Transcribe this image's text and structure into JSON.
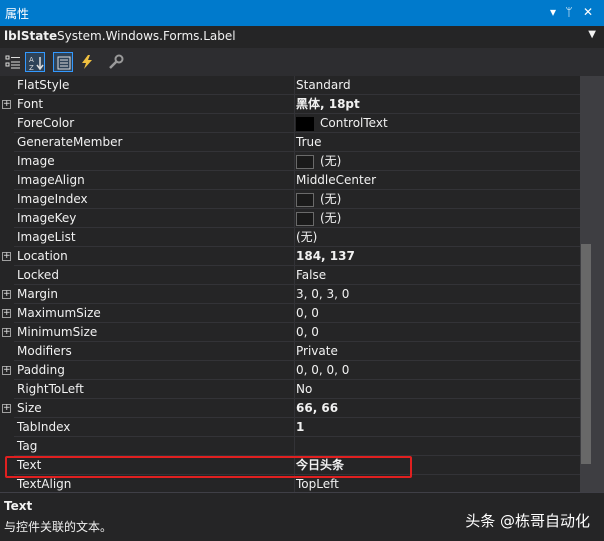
{
  "window": {
    "title": "属性"
  },
  "title_buttons": {
    "dropdown": "▾",
    "pin": "ᛘ",
    "close": "✕"
  },
  "object_selector": {
    "name": "lblState",
    "type": "System.Windows.Forms.Label"
  },
  "toolbar": {
    "buttons": [
      {
        "name": "categorized-icon",
        "active": false
      },
      {
        "name": "alphabetical-sort-icon",
        "active": true
      },
      {
        "name": "properties-icon",
        "active": true
      },
      {
        "name": "events-lightning-icon",
        "active": false
      },
      {
        "name": "property-pages-wrench-icon",
        "active": false
      }
    ]
  },
  "properties": [
    {
      "name": "FlatStyle",
      "value": "Standard",
      "expandable": false,
      "bold": false,
      "swatch": "none"
    },
    {
      "name": "Font",
      "value": "黑体, 18pt",
      "expandable": true,
      "bold": true,
      "swatch": "none"
    },
    {
      "name": "ForeColor",
      "value": "ControlText",
      "expandable": false,
      "bold": false,
      "swatch": "black"
    },
    {
      "name": "GenerateMember",
      "value": "True",
      "expandable": false,
      "bold": false,
      "swatch": "none"
    },
    {
      "name": "Image",
      "value": "(无)",
      "expandable": false,
      "bold": false,
      "swatch": "empty"
    },
    {
      "name": "ImageAlign",
      "value": "MiddleCenter",
      "expandable": false,
      "bold": false,
      "swatch": "none"
    },
    {
      "name": "ImageIndex",
      "value": "(无)",
      "expandable": false,
      "bold": false,
      "swatch": "empty"
    },
    {
      "name": "ImageKey",
      "value": "(无)",
      "expandable": false,
      "bold": false,
      "swatch": "empty"
    },
    {
      "name": "ImageList",
      "value": "(无)",
      "expandable": false,
      "bold": false,
      "swatch": "none"
    },
    {
      "name": "Location",
      "value": "184, 137",
      "expandable": true,
      "bold": true,
      "swatch": "none"
    },
    {
      "name": "Locked",
      "value": "False",
      "expandable": false,
      "bold": false,
      "swatch": "none"
    },
    {
      "name": "Margin",
      "value": "3, 0, 3, 0",
      "expandable": true,
      "bold": false,
      "swatch": "none"
    },
    {
      "name": "MaximumSize",
      "value": "0, 0",
      "expandable": true,
      "bold": false,
      "swatch": "none"
    },
    {
      "name": "MinimumSize",
      "value": "0, 0",
      "expandable": true,
      "bold": false,
      "swatch": "none"
    },
    {
      "name": "Modifiers",
      "value": "Private",
      "expandable": false,
      "bold": false,
      "swatch": "none"
    },
    {
      "name": "Padding",
      "value": "0, 0, 0, 0",
      "expandable": true,
      "bold": false,
      "swatch": "none"
    },
    {
      "name": "RightToLeft",
      "value": "No",
      "expandable": false,
      "bold": false,
      "swatch": "none"
    },
    {
      "name": "Size",
      "value": "66, 66",
      "expandable": true,
      "bold": true,
      "swatch": "none"
    },
    {
      "name": "TabIndex",
      "value": "1",
      "expandable": false,
      "bold": true,
      "swatch": "none"
    },
    {
      "name": "Tag",
      "value": "",
      "expandable": false,
      "bold": false,
      "swatch": "none"
    },
    {
      "name": "Text",
      "value": "今日头条",
      "expandable": false,
      "bold": true,
      "swatch": "none"
    },
    {
      "name": "TextAlign",
      "value": "TopLeft",
      "expandable": false,
      "bold": false,
      "swatch": "none"
    }
  ],
  "description": {
    "title": "Text",
    "text": "与控件关联的文本。"
  },
  "watermark": "头条 @栋哥自动化",
  "colors": {
    "accent": "#007acc",
    "highlight": "#e02020",
    "background": "#252526"
  }
}
